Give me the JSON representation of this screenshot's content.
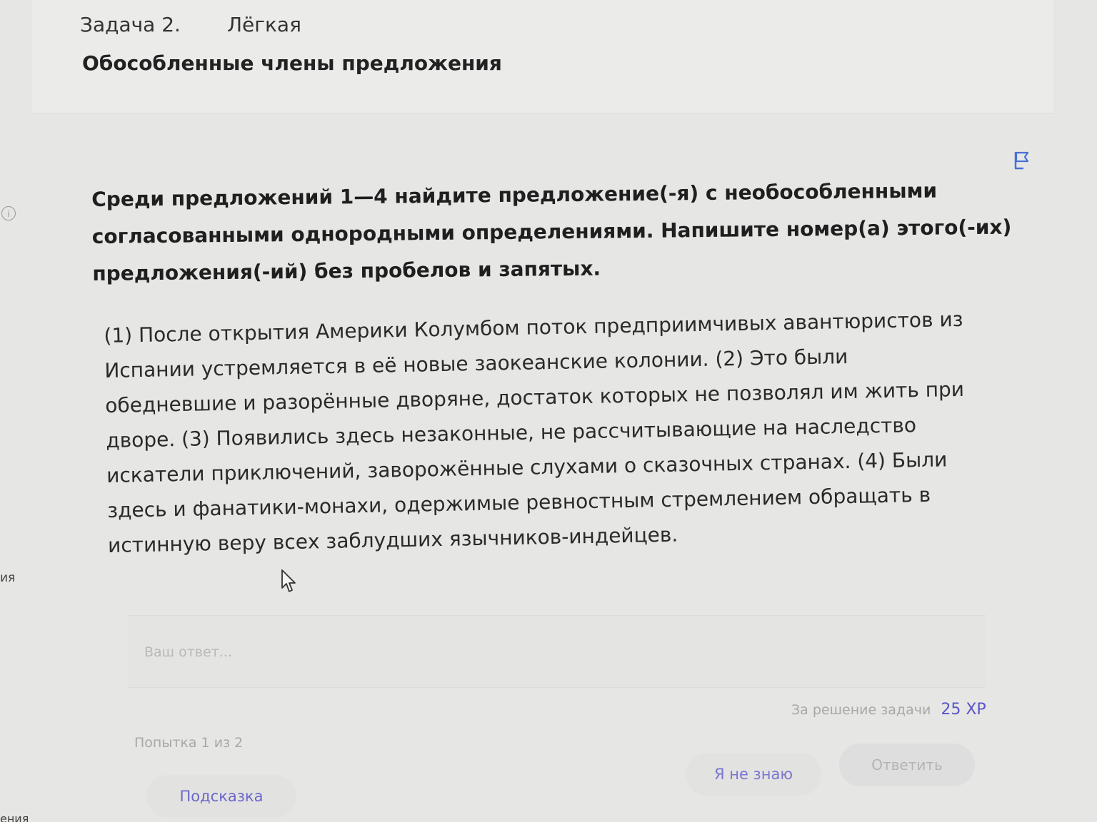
{
  "header": {
    "task_number": "Задача 2.",
    "difficulty": "Лёгкая",
    "topic": "Обособленные члены предложения"
  },
  "left_edge": {
    "info_glyph": "i",
    "partial_label": "ия",
    "partial_label_bottom": "ения"
  },
  "question": {
    "text": "Среди предложений 1—4 найдите предложение(-я) с необособленными согласованными однородными определениями. Напишите номер(а) этого(-их) предложения(-ий) без пробелов и запятых."
  },
  "passage": {
    "text": "(1) После открытия Америки Колумбом поток предприимчивых авантюристов из Испании устремляется в её новые заокеанские колонии. (2) Это были обедневшие и разорённые дворяне, достаток которых не позволял им жить при дворе. (3) Появились здесь незаконные, не рассчитывающие на наследство искатели приключений, заворожённые слухами о сказочных странах. (4) Были здесь и фанатики-монахи, одержимые ревностным стремлением обращать в истинную веру всех заблудших язычников-индейцев."
  },
  "answer": {
    "placeholder": "Ваш ответ...",
    "value": ""
  },
  "reward": {
    "label": "За решение задачи",
    "value": "25 XP"
  },
  "attempt": {
    "text": "Попытка 1 из 2"
  },
  "buttons": {
    "hint": "Подсказка",
    "dont_know": "Я не знаю",
    "submit": "Ответить"
  },
  "colors": {
    "accent": "#5a55c9",
    "background": "#e6e6e4"
  },
  "icons": {
    "flag": "flag-icon",
    "info": "info-icon",
    "cursor": "cursor-icon"
  }
}
